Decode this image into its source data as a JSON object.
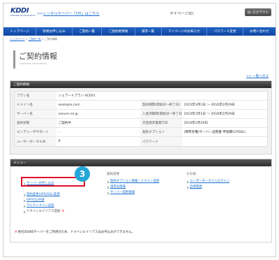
{
  "header": {
    "logo_text": "KDDI",
    "logo_sub": "KDDI Web Communications",
    "link_prefix": ">>",
    "link_text": "レンタルサーバー「CPI」はこちら",
    "my_id_label": "マイページID：",
    "logout_label": "ログアウト"
  },
  "nav": [
    "トップページ",
    "新規お申し込み",
    "ご契約一覧",
    "ご契約者情報",
    "請求一覧",
    "マイページのお知らせ",
    "パスワード変更",
    "お問い合わせ"
  ],
  "breadcrumb": {
    "items": [
      "トップページ",
      "ご契約一覧"
    ],
    "current": "ご契約情報",
    "separator": " > "
  },
  "page": {
    "title": "ご契約情報",
    "subtitle": "Contract information",
    "back_link": "<< 一覧へ戻る"
  },
  "contract": {
    "section_title": "ご契約情報",
    "rows": [
      {
        "label": "プラン名",
        "value": "シェアードプラン ACE01",
        "label2": "",
        "value2": ""
      },
      {
        "label": "ドメイン名",
        "value": "example.com",
        "label2": "契約期間(開始日～終了日)",
        "value2": "2015年3月1日 ～ 2016年2月29日"
      },
      {
        "label": "サーバー名",
        "value": "secure.ne.jp",
        "label2": "入金済期間(開始日～終了日)",
        "value2": "2015年3月1日 ～ 2016年2月29日"
      },
      {
        "label": "契約状態",
        "value": "ご契約中",
        "label2": "次回請求書発行日",
        "value2": "2016年2月29日"
      },
      {
        "label": "エンデューザサポート",
        "value": "-",
        "label2": "契約オプション",
        "value2": "(標準装備)サーバー証明書 申請費(CPISSL)"
      },
      {
        "label": "ユーザーポータルID",
        "value": "R",
        "label2": "パスワード",
        "value2": ""
      }
    ]
  },
  "menu": {
    "section_title": "メニュー",
    "step_number": "3",
    "col1": {
      "items": [
        "サーバーお申し込み",
        "契約変更(VPS(SSL)変更",
        "SPF打込申請",
        "マルチドメイン追加",
        "ドメインエイリアス追加"
      ],
      "mark": "※"
    },
    "col2": {
      "title": "契約変更",
      "items": [
        "契約オプション情報・ドメイン変更",
        "請求先情報",
        "サーバー契約情報"
      ]
    },
    "col3": {
      "title": "その他",
      "items": [
        "ユーザーポータルへログイン",
        "自律登録"
      ]
    },
    "note_mark": "※",
    "note": "他社のDNSサーバーをご利用のため、ドメインエイリアスはお申込みができません。"
  },
  "colors": {
    "nav": "#1b55b3",
    "section_head": "#3a3a3a",
    "link": "#1b6fd1",
    "highlight": "#e0112b",
    "badge": "#23a7d8"
  }
}
